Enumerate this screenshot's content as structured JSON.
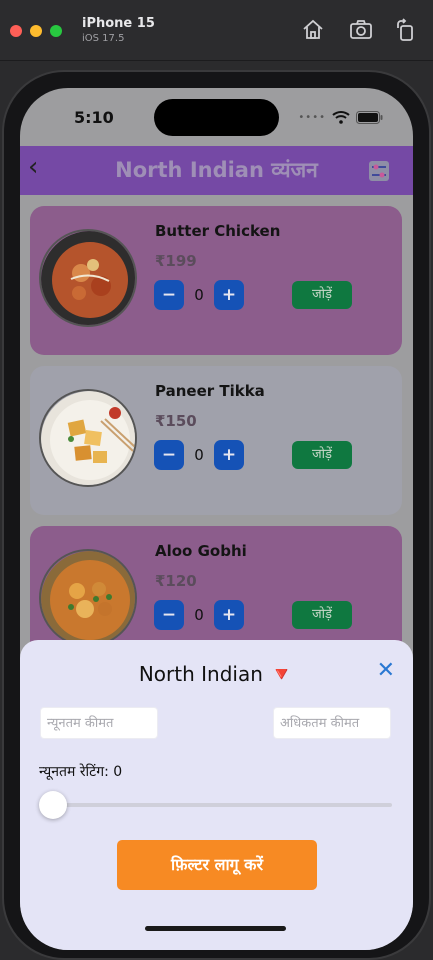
{
  "simulator": {
    "device_name": "iPhone 15",
    "os_version": "iOS 17.5"
  },
  "status_bar": {
    "time": "5:10"
  },
  "header": {
    "title": "North Indian व्यंजन",
    "color": "#7549a5"
  },
  "menu": {
    "items": [
      {
        "name": "Butter Chicken",
        "price": "₹199",
        "quantity": "0",
        "add_label": "जोड़ें",
        "card_color": "#8c5d8c"
      },
      {
        "name": "Paneer Tikka",
        "price": "₹150",
        "quantity": "0",
        "add_label": "जोड़ें",
        "card_color": "#a0a1ab"
      },
      {
        "name": "Aloo Gobhi",
        "price": "₹120",
        "quantity": "0",
        "add_label": "जोड़ें",
        "card_color": "#8c5d8c"
      }
    ],
    "minus_label": "−",
    "plus_label": "+"
  },
  "filter_sheet": {
    "title": "North Indian 🔻",
    "close_label": "✕",
    "min_price_placeholder": "न्यूनतम कीमत",
    "max_price_placeholder": "अधिकतम कीमत",
    "min_rating_label": "न्यूनतम रेटिंग: 0",
    "min_rating_value": 0,
    "apply_label": "फ़िल्टर लागू करें",
    "apply_color": "#f78a23"
  },
  "icons": [
    "home-icon",
    "screenshot-icon",
    "rotate-icon",
    "back-chevron-icon",
    "filter-sliders-icon",
    "wifi-icon",
    "battery-icon",
    "close-icon"
  ]
}
